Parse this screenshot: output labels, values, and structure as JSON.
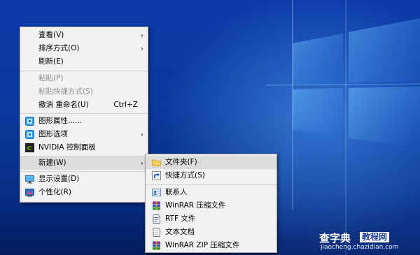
{
  "context_menu": {
    "items": [
      {
        "label": "查看(V)",
        "shortcut": "",
        "submenu": true,
        "disabled": false,
        "icon": ""
      },
      {
        "label": "排序方式(O)",
        "shortcut": "",
        "submenu": true,
        "disabled": false,
        "icon": ""
      },
      {
        "label": "刷新(E)",
        "shortcut": "",
        "submenu": false,
        "disabled": false,
        "icon": ""
      },
      {
        "label": "粘贴(P)",
        "shortcut": "",
        "submenu": false,
        "disabled": true,
        "icon": ""
      },
      {
        "label": "粘贴快捷方式(S)",
        "shortcut": "",
        "submenu": false,
        "disabled": true,
        "icon": ""
      },
      {
        "label": "撤消 重命名(U)",
        "shortcut": "Ctrl+Z",
        "submenu": false,
        "disabled": false,
        "icon": ""
      },
      {
        "label": "图形属性......",
        "shortcut": "",
        "submenu": false,
        "disabled": false,
        "icon": "intel-graphics-icon"
      },
      {
        "label": "图形选项",
        "shortcut": "",
        "submenu": true,
        "disabled": false,
        "icon": "intel-graphics-icon"
      },
      {
        "label": "NVIDIA 控制面板",
        "shortcut": "",
        "submenu": false,
        "disabled": false,
        "icon": "nvidia-icon"
      },
      {
        "label": "新建(W)",
        "shortcut": "",
        "submenu": true,
        "disabled": false,
        "icon": ""
      },
      {
        "label": "显示设置(D)",
        "shortcut": "",
        "submenu": false,
        "disabled": false,
        "icon": "display-settings-icon"
      },
      {
        "label": "个性化(R)",
        "shortcut": "",
        "submenu": false,
        "disabled": false,
        "icon": "personalize-icon"
      }
    ],
    "arrow": "›"
  },
  "new_submenu": {
    "items": [
      {
        "label": "文件夹(F)",
        "icon": "folder-icon"
      },
      {
        "label": "快捷方式(S)",
        "icon": "shortcut-icon"
      },
      {
        "label": "联系人",
        "icon": "contact-icon"
      },
      {
        "label": "WinRAR 压缩文件",
        "icon": "winrar-icon"
      },
      {
        "label": "RTF 文件",
        "icon": "rtf-document-icon"
      },
      {
        "label": "文本文档",
        "icon": "text-document-icon"
      },
      {
        "label": "WinRAR ZIP 压缩文件",
        "icon": "winrar-zip-icon"
      }
    ]
  },
  "watermark": {
    "title": "查字典",
    "tag": "教程网",
    "url": "jiaocheng.chazidian.com"
  },
  "colors": {
    "menu_bg": "#f2f2f2",
    "hover_bg": "#dcdcdc",
    "disabled_text": "#8d8d8d",
    "desktop_blue": "#0b3aa8"
  }
}
